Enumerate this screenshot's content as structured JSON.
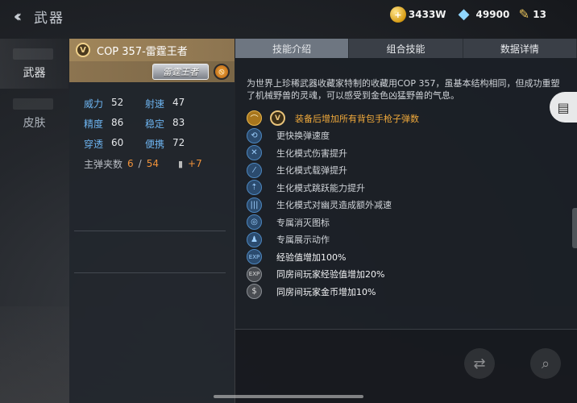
{
  "header": {
    "back_icon": "double-chevron-left",
    "title": "武器"
  },
  "currencies": [
    {
      "icon": "gold-coin-icon",
      "value": "3433W"
    },
    {
      "icon": "diamond-icon",
      "value": "49900"
    },
    {
      "icon": "pen-icon",
      "value": "13"
    }
  ],
  "nav": {
    "items": [
      {
        "label": "武器",
        "active": true
      },
      {
        "label": "皮肤",
        "active": false
      }
    ]
  },
  "weapon": {
    "name": "COP 357-雷霆王者",
    "tag": "雷霆王者",
    "stats": [
      {
        "label": "威力",
        "value": "52"
      },
      {
        "label": "射速",
        "value": "47"
      },
      {
        "label": "精度",
        "value": "86"
      },
      {
        "label": "稳定",
        "value": "83"
      },
      {
        "label": "穿透",
        "value": "60"
      },
      {
        "label": "便携",
        "value": "72"
      }
    ],
    "ammo": {
      "label": "主弹夹数",
      "current": "6",
      "separator": "/",
      "total": "54",
      "bonus": "+7"
    }
  },
  "tabs": [
    {
      "label": "技能介绍",
      "active": true
    },
    {
      "label": "组合技能",
      "active": false
    },
    {
      "label": "数据详情",
      "active": false
    }
  ],
  "description": "为世界上珍稀武器收藏家特制的收藏用COP 357，虽基本结构相同，但成功重塑了机械野兽的灵魂，可以感受到金色凶猛野兽的气息。",
  "skills": [
    {
      "text": "装备后增加所有背包手枪子弹数",
      "icon": "ammo-boost-icon",
      "style": "gold"
    },
    {
      "text": "更快换弹速度",
      "icon": "reload-icon",
      "style": "blue"
    },
    {
      "text": "生化模式伤害提升",
      "icon": "damage-up-icon",
      "style": "blue"
    },
    {
      "text": "生化模式载弹提升",
      "icon": "ammo-capacity-icon",
      "style": "blue"
    },
    {
      "text": "生化模式跳跃能力提升",
      "icon": "jump-icon",
      "style": "blue"
    },
    {
      "text": "生化模式对幽灵造成额外减速",
      "icon": "slow-icon",
      "style": "blue"
    },
    {
      "text": "专属消灭图标",
      "icon": "kill-mark-icon",
      "style": "blue"
    },
    {
      "text": "专属展示动作",
      "icon": "showcase-icon",
      "style": "blue"
    },
    {
      "text": "经验值增加100%",
      "icon": "exp-icon",
      "style": "blue"
    },
    {
      "text": "同房间玩家经验值增加20%",
      "icon": "room-exp-icon",
      "style": "grey"
    },
    {
      "text": "同房间玩家金币增加10%",
      "icon": "room-coin-icon",
      "style": "grey"
    }
  ]
}
